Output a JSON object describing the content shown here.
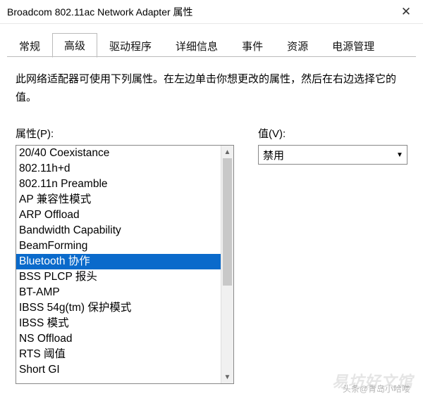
{
  "window": {
    "title": "Broadcom 802.11ac Network Adapter 属性"
  },
  "tabs": {
    "items": [
      {
        "label": "常规"
      },
      {
        "label": "高级"
      },
      {
        "label": "驱动程序"
      },
      {
        "label": "详细信息"
      },
      {
        "label": "事件"
      },
      {
        "label": "资源"
      },
      {
        "label": "电源管理"
      }
    ],
    "active_index": 1
  },
  "description": "此网络适配器可使用下列属性。在左边单击你想更改的属性，然后在右边选择它的值。",
  "property": {
    "label": "属性(P):",
    "items": [
      "20/40 Coexistance",
      "802.11h+d",
      "802.11n Preamble",
      "AP 兼容性模式",
      "ARP Offload",
      "Bandwidth Capability",
      "BeamForming",
      "Bluetooth 协作",
      "BSS PLCP 报头",
      "BT-AMP",
      "IBSS 54g(tm) 保护模式",
      "IBSS 模式",
      "NS Offload",
      "RTS 阈值",
      "Short GI"
    ],
    "selected_index": 7
  },
  "value": {
    "label": "值(V):",
    "selected": "禁用"
  },
  "watermark": {
    "main": "易坊好文馆",
    "sub": "头条@青岛小哈喽"
  }
}
